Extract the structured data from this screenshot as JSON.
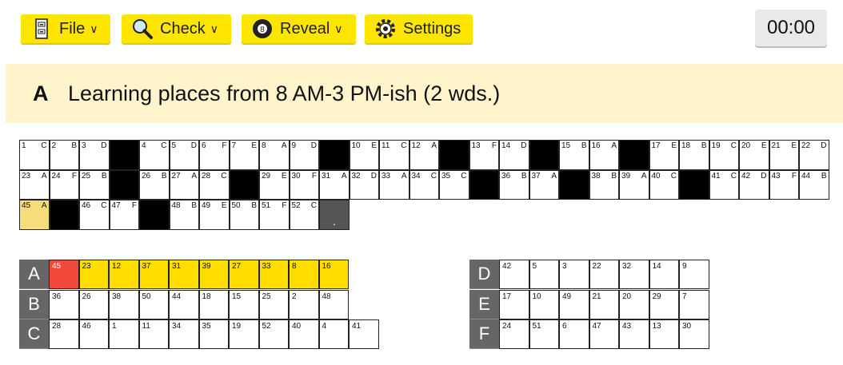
{
  "toolbar": {
    "file": {
      "label": "File",
      "icon": "file-cabinet-icon"
    },
    "check": {
      "label": "Check",
      "icon": "magnifier-icon"
    },
    "reveal": {
      "label": "Reveal",
      "icon": "eight-ball-icon"
    },
    "settings": {
      "label": "Settings",
      "icon": "gear-icon"
    },
    "timer": "00:00"
  },
  "clue": {
    "letter": "A",
    "text": "Learning places from 8 AM-3 PM-ish (2 wds.)"
  },
  "colors": {
    "accent": "#ffe500",
    "highlight": "#f7dc7b",
    "selected": "#f14a3c",
    "clue_bg": "#fff4cc"
  },
  "grid": [
    [
      {
        "n": "1",
        "l": "C"
      },
      {
        "n": "2",
        "l": "B"
      },
      {
        "n": "3",
        "l": "D"
      },
      {
        "black": true
      },
      {
        "n": "4",
        "l": "C"
      },
      {
        "n": "5",
        "l": "D"
      },
      {
        "n": "6",
        "l": "F"
      },
      {
        "n": "7",
        "l": "E"
      },
      {
        "n": "8",
        "l": "A"
      },
      {
        "n": "9",
        "l": "D"
      },
      {
        "black": true
      },
      {
        "n": "10",
        "l": "E"
      },
      {
        "n": "11",
        "l": "C"
      },
      {
        "n": "12",
        "l": "A"
      },
      {
        "black": true
      },
      {
        "n": "13",
        "l": "F"
      },
      {
        "n": "14",
        "l": "D"
      },
      {
        "black": true
      },
      {
        "n": "15",
        "l": "B"
      },
      {
        "n": "16",
        "l": "A"
      },
      {
        "black": true
      },
      {
        "n": "17",
        "l": "E"
      },
      {
        "n": "18",
        "l": "B"
      },
      {
        "n": "19",
        "l": "C"
      },
      {
        "n": "20",
        "l": "E"
      },
      {
        "n": "21",
        "l": "E"
      },
      {
        "n": "22",
        "l": "D"
      }
    ],
    [
      {
        "n": "23",
        "l": "A"
      },
      {
        "n": "24",
        "l": "F"
      },
      {
        "n": "25",
        "l": "B"
      },
      {
        "black": true
      },
      {
        "n": "26",
        "l": "B"
      },
      {
        "n": "27",
        "l": "A"
      },
      {
        "n": "28",
        "l": "C"
      },
      {
        "black": true
      },
      {
        "n": "29",
        "l": "E"
      },
      {
        "n": "30",
        "l": "F"
      },
      {
        "n": "31",
        "l": "A"
      },
      {
        "n": "32",
        "l": "D"
      },
      {
        "n": "33",
        "l": "A"
      },
      {
        "n": "34",
        "l": "C"
      },
      {
        "n": "35",
        "l": "C"
      },
      {
        "black": true
      },
      {
        "n": "36",
        "l": "B"
      },
      {
        "n": "37",
        "l": "A"
      },
      {
        "black": true
      },
      {
        "n": "38",
        "l": "B"
      },
      {
        "n": "39",
        "l": "A"
      },
      {
        "n": "40",
        "l": "C"
      },
      {
        "black": true
      },
      {
        "n": "41",
        "l": "C"
      },
      {
        "n": "42",
        "l": "D"
      },
      {
        "n": "43",
        "l": "F"
      },
      {
        "n": "44",
        "l": "B"
      }
    ],
    [
      {
        "n": "45",
        "l": "A",
        "hl": true
      },
      {
        "black": true
      },
      {
        "n": "46",
        "l": "C"
      },
      {
        "n": "47",
        "l": "F"
      },
      {
        "black": true
      },
      {
        "n": "48",
        "l": "B"
      },
      {
        "n": "49",
        "l": "E"
      },
      {
        "n": "50",
        "l": "B"
      },
      {
        "n": "51",
        "l": "F"
      },
      {
        "n": "52",
        "l": "C"
      },
      {
        "punct": "."
      }
    ]
  ],
  "word_grid_left": [
    {
      "label": "A",
      "cells": [
        {
          "n": "45",
          "state": "red"
        },
        {
          "n": "23",
          "state": "yel"
        },
        {
          "n": "12",
          "state": "yel"
        },
        {
          "n": "37",
          "state": "yel"
        },
        {
          "n": "31",
          "state": "yel"
        },
        {
          "n": "39",
          "state": "yel"
        },
        {
          "n": "27",
          "state": "yel"
        },
        {
          "n": "33",
          "state": "yel"
        },
        {
          "n": "8",
          "state": "yel"
        },
        {
          "n": "16",
          "state": "yel"
        }
      ]
    },
    {
      "label": "B",
      "cells": [
        {
          "n": "36"
        },
        {
          "n": "26"
        },
        {
          "n": "38"
        },
        {
          "n": "50"
        },
        {
          "n": "44"
        },
        {
          "n": "18"
        },
        {
          "n": "15"
        },
        {
          "n": "25"
        },
        {
          "n": "2"
        },
        {
          "n": "48"
        }
      ]
    },
    {
      "label": "C",
      "cells": [
        {
          "n": "28"
        },
        {
          "n": "46"
        },
        {
          "n": "1"
        },
        {
          "n": "11"
        },
        {
          "n": "34"
        },
        {
          "n": "35"
        },
        {
          "n": "19"
        },
        {
          "n": "52"
        },
        {
          "n": "40"
        },
        {
          "n": "4"
        },
        {
          "n": "41"
        }
      ]
    }
  ],
  "word_grid_right": [
    {
      "label": "D",
      "cells": [
        {
          "n": "42"
        },
        {
          "n": "5"
        },
        {
          "n": "3"
        },
        {
          "n": "22"
        },
        {
          "n": "32"
        },
        {
          "n": "14"
        },
        {
          "n": "9"
        }
      ]
    },
    {
      "label": "E",
      "cells": [
        {
          "n": "17"
        },
        {
          "n": "10"
        },
        {
          "n": "49"
        },
        {
          "n": "21"
        },
        {
          "n": "20"
        },
        {
          "n": "29"
        },
        {
          "n": "7"
        }
      ]
    },
    {
      "label": "F",
      "cells": [
        {
          "n": "24"
        },
        {
          "n": "51"
        },
        {
          "n": "6"
        },
        {
          "n": "47"
        },
        {
          "n": "43"
        },
        {
          "n": "13"
        },
        {
          "n": "30"
        }
      ]
    }
  ]
}
